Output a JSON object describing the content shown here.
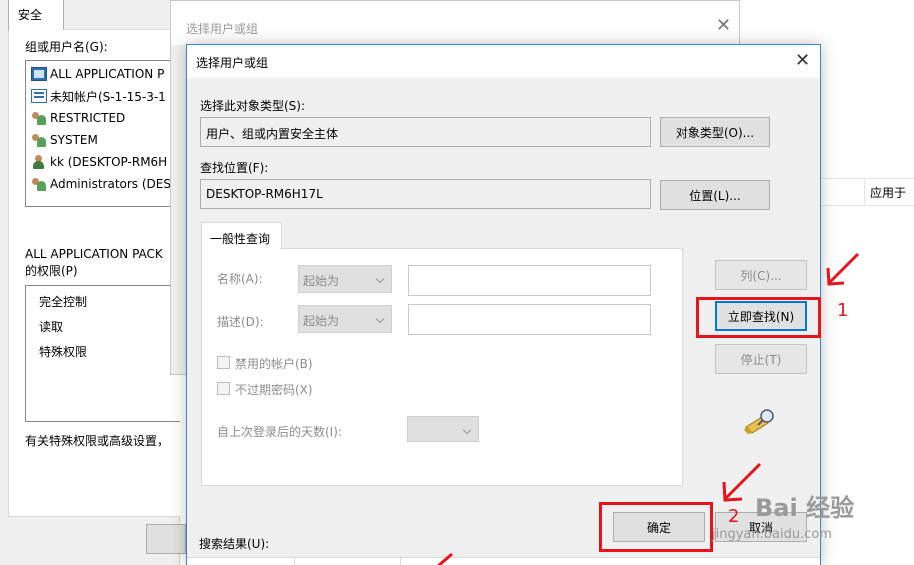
{
  "background_dialog": {
    "tab_label": "安全",
    "group_label": "组或用户名(G):",
    "users": [
      {
        "label": "ALL APPLICATION P",
        "icon": "app-package-icon"
      },
      {
        "label": "未知帐户(S-1-15-3-1",
        "icon": "unknown-account-icon"
      },
      {
        "label": "RESTRICTED",
        "icon": "group-icon"
      },
      {
        "label": "SYSTEM",
        "icon": "group-icon"
      },
      {
        "label": "kk (DESKTOP-RM6H",
        "icon": "user-icon"
      },
      {
        "label": "Administrators (DES",
        "icon": "group-icon"
      }
    ],
    "permission_label_line1": "ALL APPLICATION PACK",
    "permission_label_line2": "的权限(P)",
    "permissions": [
      "完全控制",
      "读取",
      "特殊权限"
    ],
    "advanced_text": "有关特殊权限或高级设置，"
  },
  "middle_dialog": {
    "title": "选择用户或组",
    "close_glyph": "✕"
  },
  "right_panel": {
    "column_header": "应用于"
  },
  "main_dialog": {
    "title": "选择用户或组",
    "close_glyph": "✕",
    "object_type_label": "选择此对象类型(S):",
    "object_type_value": "用户、组或内置安全主体",
    "object_types_button": "对象类型(O)...",
    "location_label": "查找位置(F):",
    "location_value": "DESKTOP-RM6H17L",
    "locations_button": "位置(L)...",
    "general_tab": "一般性查询",
    "name_label": "名称(A):",
    "name_mode": "起始为",
    "description_label": "描述(D):",
    "description_mode": "起始为",
    "disabled_accounts_label": "禁用的帐户(B)",
    "non_expiring_label": "不过期密码(X)",
    "days_since_logon_label": "自上次登录后的天数(I):",
    "columns_button": "列(C)...",
    "find_now_button": "立即查找(N)",
    "stop_button": "停止(T)",
    "ok_button": "确定",
    "cancel_button": "取消",
    "results_label": "搜索结果(U):"
  },
  "annotations": {
    "step1": "1",
    "step2": "2",
    "color": "#e8141c"
  },
  "watermark": {
    "logo_text": "Bai 经验",
    "url": "jingyan.baidu.com"
  }
}
